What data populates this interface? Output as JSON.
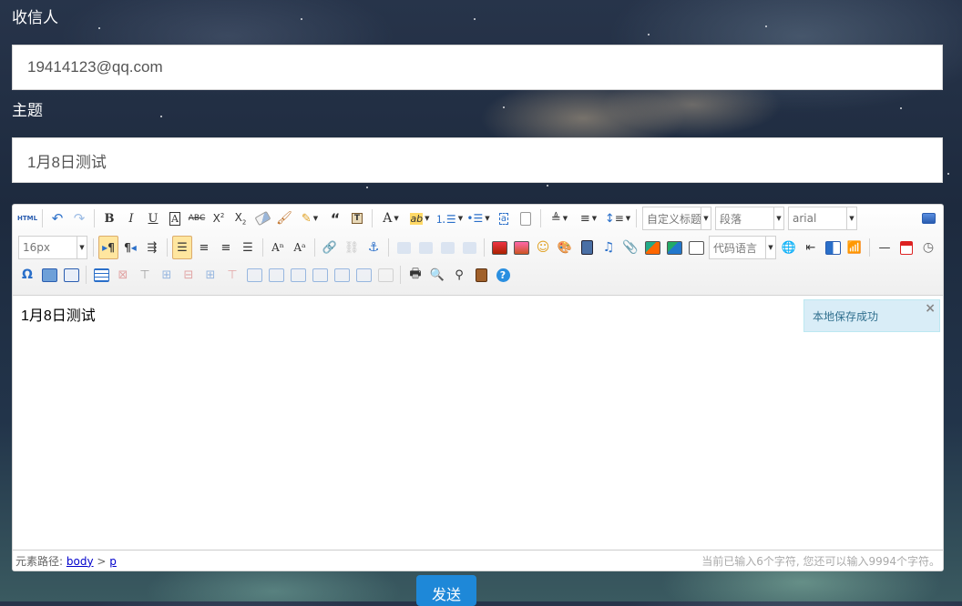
{
  "form": {
    "recipient_label": "收信人",
    "recipient_value": "19414123@qq.com",
    "subject_label": "主题",
    "subject_value": "1月8日测试",
    "send_label": "发送"
  },
  "editor": {
    "toolbar": {
      "html_label": "HTML",
      "custom_heading": "自定义标题",
      "paragraph": "段落",
      "font_family": "arial",
      "font_size": "16px",
      "code_language": "代码语言"
    },
    "content": "1月8日测试",
    "tip": {
      "text": "本地保存成功",
      "close": "×"
    },
    "status": {
      "path_label": "元素路径:",
      "path_body": "body",
      "path_sep": ">",
      "path_p": "p",
      "char_count": "当前已输入6个字符, 您还可以输入9994个字符。"
    }
  },
  "colors": {
    "send_button": "#1e88d8",
    "active_button": "#ffe69f",
    "tip_background": "#d9edf7"
  }
}
